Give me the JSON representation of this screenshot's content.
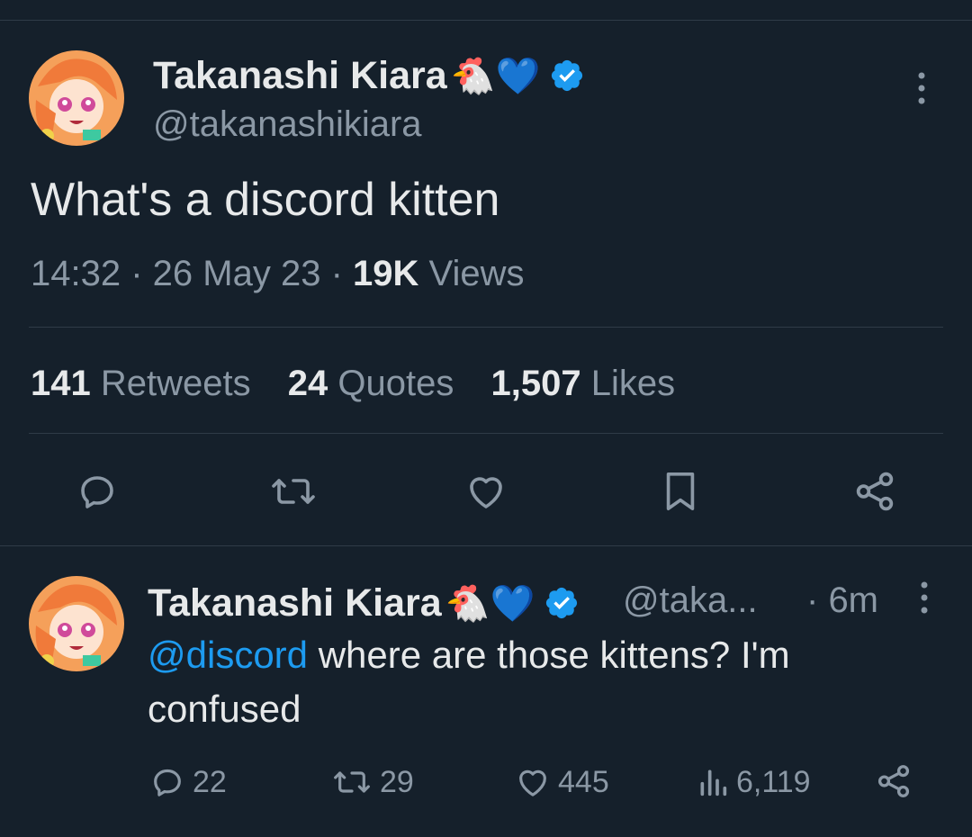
{
  "main_tweet": {
    "author_name": "Takanashi Kiara",
    "name_emojis": "🐔💙",
    "handle": "@takanashikiara",
    "text": "What's a discord kitten",
    "time": "14:32",
    "date": "26 May 23",
    "views_count": "19K",
    "views_label": "Views",
    "stats": [
      {
        "count": "141",
        "label": "Retweets"
      },
      {
        "count": "24",
        "label": "Quotes"
      },
      {
        "count": "1,507",
        "label": "Likes"
      }
    ]
  },
  "reply": {
    "author_name": "Takanashi Kiara",
    "name_emojis": "🐔💙",
    "handle": "@taka...",
    "age": "6m",
    "mention": "@discord",
    "text_line1": " where are those kittens? I'm",
    "text_line2": "confused",
    "counts": {
      "replies": "22",
      "retweets": "29",
      "likes": "445",
      "views": "6,119"
    }
  },
  "colors": {
    "background": "#15202b",
    "text": "#e7e9ea",
    "muted": "#8b98a5",
    "link": "#1d9bf0",
    "verified": "#1d9bf0",
    "divider": "#2f3b47"
  },
  "icons": [
    "more-vertical-icon",
    "verified-badge-icon",
    "reply-icon",
    "retweet-icon",
    "like-icon",
    "bookmark-icon",
    "share-icon",
    "views-icon"
  ]
}
